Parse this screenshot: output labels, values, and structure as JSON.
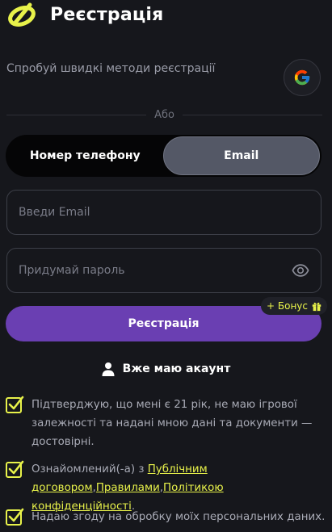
{
  "header": {
    "title": "Реєстрація",
    "logo_icon": "logo-mark-icon"
  },
  "quick_methods": {
    "label": "Спробуй швидкі методи реєстрації",
    "google_icon": "google-icon"
  },
  "divider": {
    "label": "Або"
  },
  "tabs": [
    {
      "label": "Номер телефону",
      "active": false
    },
    {
      "label": "Email",
      "active": true
    }
  ],
  "email": {
    "value": "",
    "placeholder": "Введи Email"
  },
  "password": {
    "value": "",
    "placeholder": "Придумай пароль",
    "toggle_icon": "eye-icon"
  },
  "bonus": {
    "label": "+ Бонус",
    "icon": "gift-icon"
  },
  "register": {
    "label": "Реєстрація"
  },
  "have_account": {
    "label": "Вже маю акаунт",
    "icon": "user-icon"
  },
  "checks": {
    "age": {
      "checked": true,
      "text": "Підтверджую, що мені є 21 рік, не маю ігрової залежності та надані мною дані та документи — достовірні."
    },
    "terms": {
      "checked": true,
      "prefix": "Ознайомлений(-а) з ",
      "link_public": "Публічним договором",
      "sep1": ",",
      "link_rules": "Правилами",
      "sep2": ",",
      "link_privacy": "Політикою конфіденційності",
      "suffix": "."
    },
    "consent": {
      "checked": true,
      "text": "Надаю згоду на обробку моїх персональних даних."
    }
  },
  "colors": {
    "background": "#16171c",
    "accent_yellow": "#e8f24a",
    "primary_purple": "#6a3fb2",
    "tab_active": "#545866"
  }
}
